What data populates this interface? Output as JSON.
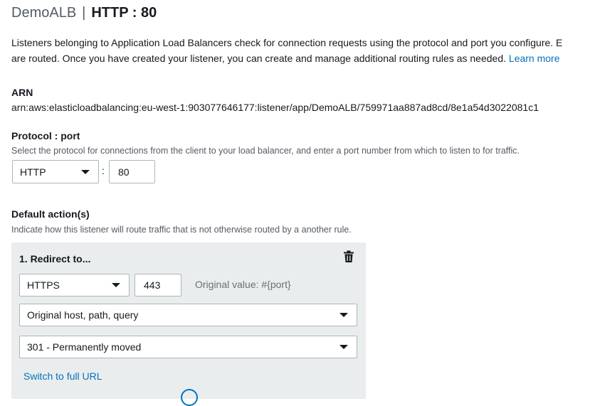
{
  "header": {
    "lb_name": "DemoALB",
    "separator": "|",
    "listener": "HTTP : 80"
  },
  "intro": {
    "line1": "Listeners belonging to Application Load Balancers check for connection requests using the protocol and port you configure. E",
    "line2": "are routed. Once you have created your listener, you can create and manage additional routing rules as needed.",
    "learn_more": "Learn more"
  },
  "arn": {
    "label": "ARN",
    "value": "arn:aws:elasticloadbalancing:eu-west-1:903077646177:listener/app/DemoALB/759971aa887ad8cd/8e1a54d3022081c1"
  },
  "protocol_port": {
    "label": "Protocol : port",
    "help": "Select the protocol for connections from the client to your load balancer, and enter a port number from which to listen to for traffic.",
    "protocol": "HTTP",
    "colon": ":",
    "port": "80"
  },
  "default_actions": {
    "label": "Default action(s)",
    "help": "Indicate how this listener will route traffic that is not otherwise routed by a another rule.",
    "action": {
      "title": "1. Redirect to...",
      "protocol": "HTTPS",
      "port": "443",
      "original_hint": "Original value: #{port}",
      "host_path_query": "Original host, path, query",
      "status_code": "301 - Permanently moved",
      "switch_link": "Switch to full URL"
    }
  },
  "icons": {
    "delete": "trash-icon",
    "dropdown": "caret-down-icon"
  },
  "colors": {
    "link": "#0073bb",
    "panel_bg": "#eaeded",
    "border": "#aab7b8"
  }
}
